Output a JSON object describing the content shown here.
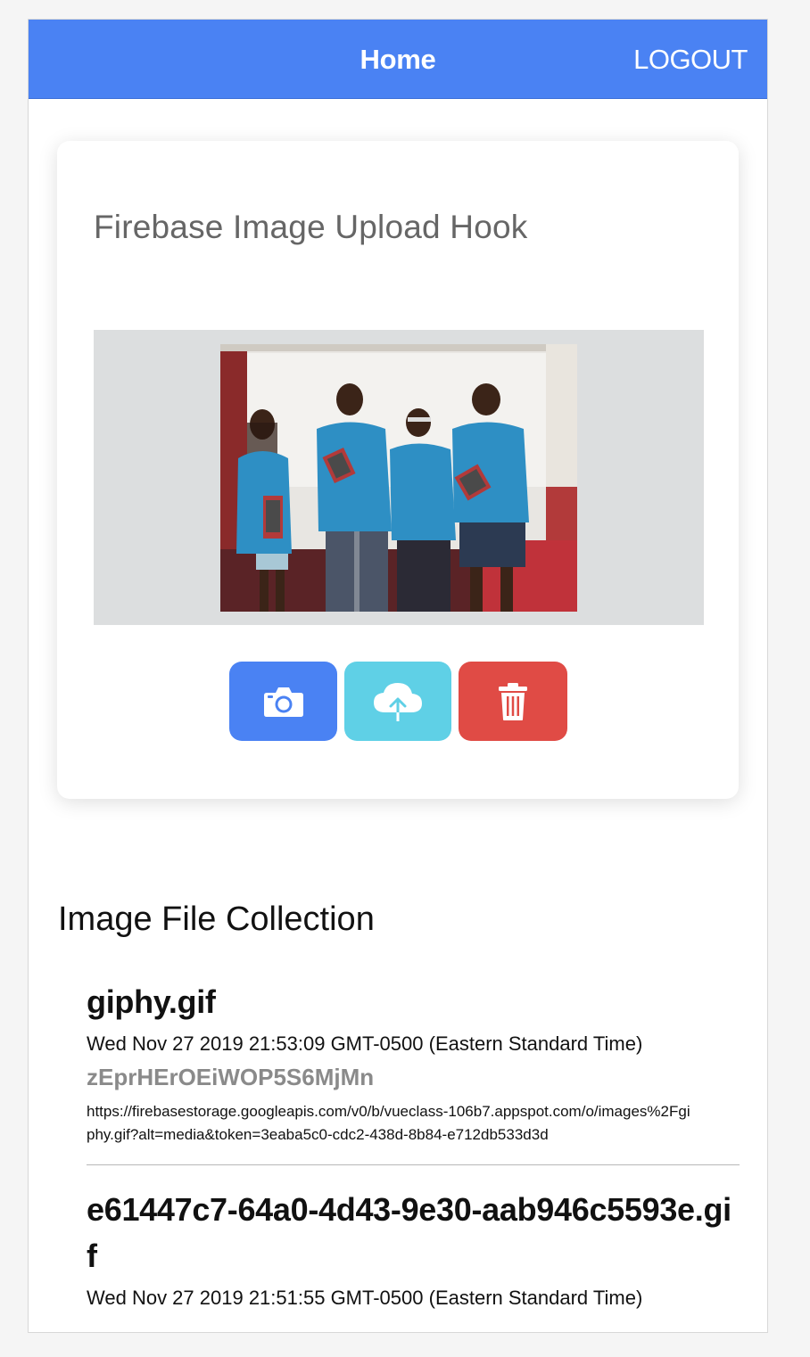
{
  "toolbar": {
    "title": "Home",
    "logout_label": "LOGOUT",
    "color": "#4a82f3"
  },
  "card": {
    "title": "Firebase Image Upload Hook",
    "preview_image": "photo of four children in blue t-shirts holding tablets",
    "buttons": [
      {
        "icon": "camera-icon",
        "color": "#4a82f3"
      },
      {
        "icon": "cloud-upload-icon",
        "color": "#5fd0e6"
      },
      {
        "icon": "trash-icon",
        "color": "#e04b45"
      }
    ]
  },
  "collection": {
    "title": "Image File Collection",
    "files": [
      {
        "name": "giphy.gif",
        "date": "Wed Nov 27 2019 21:53:09 GMT-0500 (Eastern Standard Time)",
        "id": "zEprHErOEiWOP5S6MjMn",
        "url": "https://firebasestorage.googleapis.com/v0/b/vueclass-106b7.appspot.com/o/images%2Fgiphy.gif?alt=media&token=3eaba5c0-cdc2-438d-8b84-e712db533d3d"
      },
      {
        "name": "e61447c7-64a0-4d43-9e30-aab946c5593e.gif",
        "date": "Wed Nov 27 2019 21:51:55 GMT-0500 (Eastern Standard Time)"
      }
    ]
  }
}
